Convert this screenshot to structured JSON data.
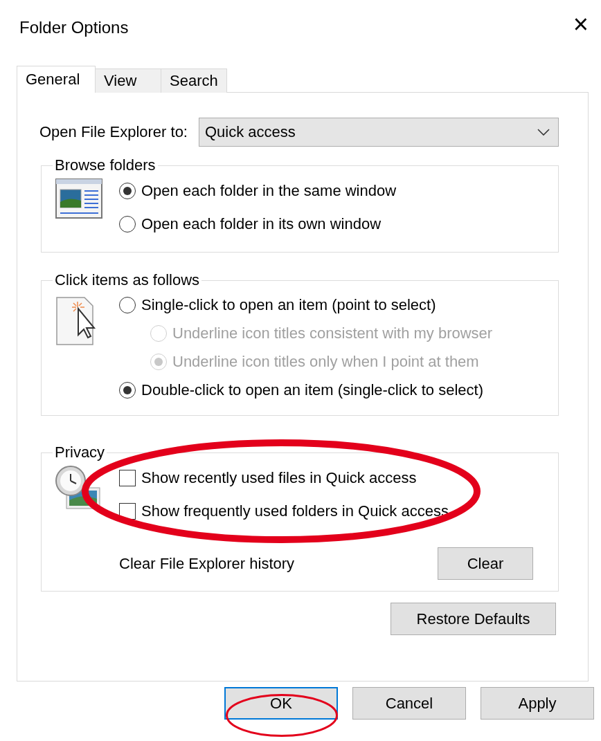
{
  "window": {
    "title": "Folder Options",
    "close": "×"
  },
  "tabs": [
    {
      "label": "General",
      "selected": true
    },
    {
      "label": "View",
      "selected": false
    },
    {
      "label": "Search",
      "selected": false
    }
  ],
  "open_to": {
    "label": "Open File Explorer to:",
    "value": "Quick access"
  },
  "browse_folders": {
    "title": "Browse folders",
    "options": [
      {
        "label": "Open each folder in the same window",
        "selected": true
      },
      {
        "label": "Open each folder in its own window",
        "selected": false
      }
    ]
  },
  "click_items": {
    "title": "Click items as follows",
    "options": [
      {
        "label": "Single-click to open an item (point to select)",
        "selected": false,
        "children": [
          {
            "label": "Underline icon titles consistent with my browser",
            "selected": false,
            "disabled": true
          },
          {
            "label": "Underline icon titles only when I point at them",
            "selected": true,
            "disabled": true
          }
        ]
      },
      {
        "label": "Double-click to open an item (single-click to select)",
        "selected": true
      }
    ]
  },
  "privacy": {
    "title": "Privacy",
    "highlighted": true,
    "checkboxes": [
      {
        "label": "Show recently used files in Quick access",
        "checked": false
      },
      {
        "label": "Show frequently used folders in Quick access",
        "checked": false
      }
    ],
    "history_label": "Clear File Explorer history",
    "clear_button": "Clear"
  },
  "restore_button": "Restore Defaults",
  "buttons": [
    {
      "label": "OK",
      "focused": true,
      "highlighted": true
    },
    {
      "label": "Cancel",
      "focused": false,
      "highlighted": false
    },
    {
      "label": "Apply",
      "focused": false,
      "highlighted": false
    }
  ]
}
